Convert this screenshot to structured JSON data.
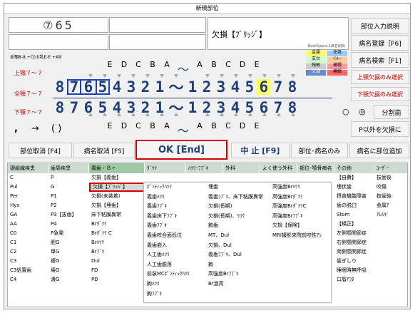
{
  "window": {
    "title": "新規部位"
  },
  "top": {
    "teeth_display": "⑦65",
    "diagnosis_display": "欠損【ﾌﾞﾘｯｼﾞ】",
    "backspace_hint": "BackSpace:1病名削除",
    "btn_input_help": "部位入力説明",
    "btn_register": "病名登録［F6]",
    "btn_search": "病名検索［F1]",
    "btn_upper_select": "上顎欠損のみ選択",
    "btn_lower_select": "下顎欠損のみ選択",
    "radio_left": "○",
    "radio_right": "◎",
    "btn_split": "分割歯",
    "btn_p_other": "P以外を欠損に"
  },
  "shortcut_hint": "全顎8-8 +Ctrl/乳E-E +Alt",
  "jaw": {
    "upper": "上顎７～７",
    "full": "全顎７～７",
    "lower": "下顎７～７"
  },
  "legend": {
    "row1a": "金属",
    "row1b": "充填",
    "row2a": "支台",
    "row2b": "ｲﾝﾚｰ",
    "row3a": "残根",
    "row3b": "補綴",
    "row4a": "欠損",
    "row4b": "補綴"
  },
  "teeth": {
    "deciduous_left": [
      "E",
      "D",
      "C",
      "B",
      "A"
    ],
    "deciduous_right": [
      "A",
      "B",
      "C",
      "D",
      "E"
    ],
    "upper_left": [
      "8",
      "7",
      "6",
      "5",
      "4",
      "3",
      "2",
      "1"
    ],
    "upper_right": [
      "1",
      "2",
      "3",
      "4",
      "5",
      "6",
      "7",
      "8"
    ],
    "lower_left": [
      "8",
      "7",
      "6",
      "5",
      "4",
      "3",
      "2",
      "1"
    ],
    "lower_right": [
      "1",
      "2",
      "3",
      "4",
      "5",
      "6",
      "7",
      "8"
    ],
    "tilde": "～"
  },
  "extra_row": {
    "comma": ",",
    "arrow": "→",
    "paren": "( )"
  },
  "actions": {
    "cancel_site": "部位取消 [F4]",
    "cancel_name": "病名取消 [F5]",
    "ok": "OK [End]",
    "abort": "中 止 [F9]",
    "site_only": "部位･病名のみ",
    "add_site": "病名に部位追加"
  },
  "columns": [
    {
      "header": "硬組織疾患",
      "items": [
        "C",
        "Pul",
        "Per",
        "Hys",
        "GA",
        "AA",
        "C0",
        "C1",
        "C2",
        "C3",
        "C3処置歯",
        "C4"
      ]
    },
    {
      "header": "歯周疾患",
      "items": [
        "P",
        "G",
        "P1",
        "P2",
        "P3【抜歯】",
        "P4",
        "P急発",
        "肥G",
        "単G",
        "複G",
        "壊G",
        "潰G"
      ]
    },
    {
      "header": "義歯・Ｂｒ",
      "items": [
        "欠損【義歯】",
        "欠損【ﾌﾞﾘｯｼﾞ】",
        "欠損(未装着)",
        "欠損【埋歯】",
        "床下粘膜異常",
        "Brﾀﾞﾂﾘ",
        "Brﾀﾞﾂﾘ C",
        "Brﾊﾂﾘ",
        "Brﾌﾞｷ",
        "Dul",
        "FD",
        "PD"
      ]
    },
    {
      "header": "ﾀﾞﾂﾘ",
      "items": []
    },
    {
      "header": "ﾊﾂﾘ･ﾌﾌﾞｷ",
      "items": []
    },
    {
      "header": "外科",
      "items": []
    },
    {
      "header": "よく使う外科",
      "items": []
    },
    {
      "header": "部位･顎骨病名",
      "items": []
    },
    {
      "header": "その他",
      "items": [
        "【自費】",
        "埋伏歯",
        "摂食機能障害",
        "歯の脱臼",
        "Stom",
        "【矯正】",
        "左側顎関節症",
        "右側顎関節症",
        "両側顎関節症",
        "歯ぎしり",
        "睡眠時無呼吸",
        "口唇ｱﾌﾀ"
      ]
    },
    {
      "header": "ﾕｰｻﾞｰ",
      "items": [
        "抜歯後",
        "咬傷",
        "抜歯後",
        "金属ｱ",
        "ｱﾚﾙｷﾞ"
      ]
    }
  ],
  "popup": {
    "col1": [
      "ﾎﾟﾝﾃｨｯｸﾊﾂﾘ",
      "義歯ﾊﾂﾘ",
      "義歯ﾌﾌﾞｷ",
      "義歯床下ﾌﾌﾞｷ",
      "義歯ﾌﾌﾞｷ",
      "義歯咬合面低位",
      "義歯嵌入",
      "人工歯ﾊﾂﾘ",
      "人工歯脱落",
      "前装MCﾎﾟﾝﾃｨｯｸﾊﾂﾘ",
      "鉤ﾊﾂﾘ",
      "鉤ﾌﾌﾞｷ"
    ],
    "col2": [
      "埋歯",
      "義歯ﾌﾌﾞｷ、床下粘膜異常",
      "欠損(長期)",
      "欠損(長期)、ﾘﾘｸ",
      "鉤歯",
      "MT、Dul",
      "欠損、Dul",
      "義歯ﾌﾌﾞｷ、Dul",
      "鉤",
      "高強度Brﾌﾌﾞｷ",
      "Br過高"
    ],
    "col3": [
      "高強度Brﾊﾂﾘ",
      "高強度Brﾀﾞﾂﾘ",
      "高強度BrﾀﾞﾂﾘC",
      "高強度Brﾌﾌﾞｷ",
      "欠損【保険】",
      "MRI撮影来院前咬性ｱｼ"
    ]
  }
}
